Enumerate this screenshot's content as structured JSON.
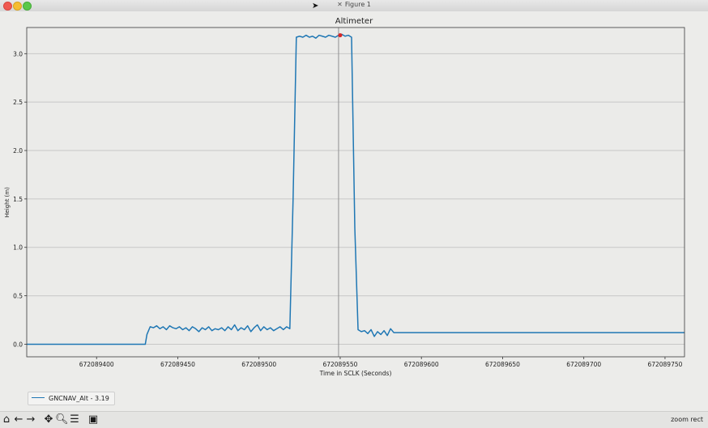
{
  "window": {
    "title": "Figure 1",
    "status": "zoom rect"
  },
  "colors": {
    "line": "#1f77b4",
    "marker": "#d62728",
    "grid": "#c7c7c7",
    "cursor_line": "#909090"
  },
  "toolbar": {
    "tools": [
      "home-icon",
      "back-arrow-icon",
      "forward-arrow-icon",
      "pan-icon",
      "zoom-icon",
      "configure-subplots-icon",
      "save-icon"
    ]
  },
  "legend": {
    "label": "GNCNAV_Alt - 3.19"
  },
  "chart_data": {
    "type": "line",
    "title": "Altimeter",
    "xlabel": "Time in SCLK (Seconds)",
    "ylabel": "Height (m)",
    "xlim": [
      672089357,
      672089762
    ],
    "ylim": [
      -0.13,
      3.27
    ],
    "xticks": [
      672089400,
      672089450,
      672089500,
      672089550,
      672089600,
      672089650,
      672089700,
      672089750
    ],
    "xtick_labels": [
      "672089400",
      "672089450",
      "672089500",
      "672089550",
      "672089600",
      "672089650",
      "672089700",
      "672089750"
    ],
    "yticks": [
      0.0,
      0.5,
      1.0,
      1.5,
      2.0,
      2.5,
      3.0
    ],
    "ytick_labels": [
      "0.0",
      "0.5",
      "1.0",
      "1.5",
      "2.0",
      "2.5",
      "3.0"
    ],
    "grid": "horizontal",
    "cursor_x": 672089549,
    "marker": {
      "x": 672089550,
      "y": 3.19
    },
    "series": [
      {
        "name": "GNCNAV_Alt - 3.19",
        "x": [
          672089357,
          672089430,
          672089431,
          672089433,
          672089435,
          672089437,
          672089439,
          672089441,
          672089443,
          672089445,
          672089447,
          672089449,
          672089451,
          672089453,
          672089455,
          672089457,
          672089459,
          672089461,
          672089463,
          672089465,
          672089467,
          672089469,
          672089471,
          672089473,
          672089475,
          672089477,
          672089479,
          672089481,
          672089483,
          672089485,
          672089487,
          672089489,
          672089491,
          672089493,
          672089495,
          672089497,
          672089499,
          672089501,
          672089503,
          672089505,
          672089507,
          672089509,
          672089511,
          672089513,
          672089515,
          672089517,
          672089519,
          672089521,
          672089523,
          672089525,
          672089527,
          672089529,
          672089531,
          672089533,
          672089535,
          672089537,
          672089539,
          672089541,
          672089543,
          672089545,
          672089547,
          672089549,
          672089551,
          672089553,
          672089555,
          672089557,
          672089559,
          672089561,
          672089563,
          672089565,
          672089567,
          672089569,
          672089571,
          672089573,
          672089575,
          672089577,
          672089579,
          672089581,
          672089583,
          672089585,
          672089762
        ],
        "y": [
          0.0,
          0.0,
          0.1,
          0.18,
          0.17,
          0.19,
          0.16,
          0.18,
          0.15,
          0.19,
          0.17,
          0.16,
          0.18,
          0.15,
          0.17,
          0.14,
          0.18,
          0.16,
          0.13,
          0.17,
          0.15,
          0.18,
          0.14,
          0.16,
          0.15,
          0.17,
          0.14,
          0.18,
          0.15,
          0.2,
          0.14,
          0.17,
          0.15,
          0.19,
          0.13,
          0.17,
          0.2,
          0.14,
          0.18,
          0.15,
          0.17,
          0.14,
          0.16,
          0.18,
          0.15,
          0.18,
          0.16,
          1.5,
          3.17,
          3.18,
          3.17,
          3.19,
          3.17,
          3.18,
          3.16,
          3.19,
          3.18,
          3.17,
          3.19,
          3.18,
          3.17,
          3.19,
          3.2,
          3.18,
          3.19,
          3.17,
          1.2,
          0.15,
          0.13,
          0.14,
          0.11,
          0.15,
          0.08,
          0.13,
          0.1,
          0.14,
          0.09,
          0.16,
          0.12,
          0.12,
          0.12
        ]
      }
    ]
  }
}
